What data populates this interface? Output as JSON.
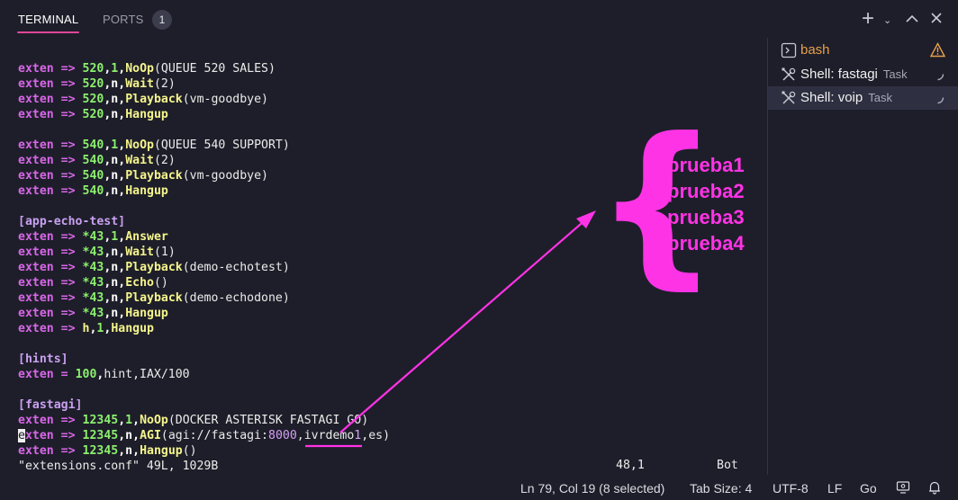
{
  "header": {
    "tab_terminal": "TERMINAL",
    "tab_ports": "PORTS",
    "ports_count": "1",
    "icons": [
      "plus-icon",
      "chevron-down-icon",
      "chevron-up-icon",
      "close-icon"
    ]
  },
  "terminal": {
    "extens": {
      "e1": "exten",
      "e2": "exten",
      "e3": "exten",
      "e4": "exten",
      "e5": "exten",
      "e6": "exten",
      "e7": "exten",
      "e8": "exten",
      "e9": "exten",
      "e10": "exten",
      "e11": "exten",
      "e12": "exten",
      "e13": "exten",
      "e14": "exten",
      "e15": "exten"
    },
    "lines": {
      "l1": {
        "num": "520",
        "prio": "1",
        "app": "NoOp",
        "arg": "(QUEUE 520 SALES)"
      },
      "l2": {
        "num": "520",
        "prio": "n",
        "app": "Wait",
        "arg": "(2)"
      },
      "l3": {
        "num": "520",
        "prio": "n",
        "app": "Playback",
        "arg": "(vm-goodbye)"
      },
      "l4": {
        "num": "520",
        "prio": "n",
        "app": "Hangup",
        "arg": ""
      },
      "l5": {
        "num": "540",
        "prio": "1",
        "app": "NoOp",
        "arg": "(QUEUE 540 SUPPORT)"
      },
      "l6": {
        "num": "540",
        "prio": "n",
        "app": "Wait",
        "arg": "(2)"
      },
      "l7": {
        "num": "540",
        "prio": "n",
        "app": "Playback",
        "arg": "(vm-goodbye)"
      },
      "l8": {
        "num": "540",
        "prio": "n",
        "app": "Hangup",
        "arg": ""
      },
      "l9": {
        "num": "*43",
        "prio": "1",
        "app": "Answer",
        "arg": ""
      },
      "l10": {
        "num": "*43",
        "prio": "n",
        "app": "Wait",
        "arg": "(1)"
      },
      "l11": {
        "num": "*43",
        "prio": "n",
        "app": "Playback",
        "arg": "(demo-echotest)"
      },
      "l12": {
        "num": "*43",
        "prio": "n",
        "app": "Echo",
        "arg": "()"
      },
      "l13": {
        "num": "*43",
        "prio": "n",
        "app": "Playback",
        "arg": "(demo-echodone)"
      },
      "l14": {
        "num": "*43",
        "prio": "n",
        "app": "Hangup",
        "arg": ""
      },
      "l15": {
        "num": "h",
        "prio": "1",
        "app": "Hangup",
        "arg": ""
      },
      "l16": {
        "num": "100",
        "prio": "hint",
        "arg": ",IAX/100"
      },
      "l17": {
        "num": "12345",
        "prio": "1",
        "app": "NoOp",
        "arg": "(DOCKER ASTERISK FASTAGI GO)"
      },
      "l18": {
        "num": "12345",
        "prio": "n",
        "app": "AGI",
        "arg_a": "(agi://fastagi:",
        "arg_port": "8000",
        "arg_b": ",ivrdemo",
        "arg_one": "1",
        "arg_c": ",es)"
      },
      "l19": {
        "num": "12345",
        "prio": "n",
        "app": "Hangup",
        "arg": "()"
      }
    },
    "contexts": {
      "echo": "[app-echo-test]",
      "hints": "[hints]",
      "fastagi": "[fastagi]"
    },
    "arrow": "=>",
    "equals": "=",
    "cursor_char": "e",
    "cursor_rest": "xten",
    "file_status": "\"extensions.conf\" 49L, 1029B",
    "vim_position": "48,1",
    "vim_scroll": "Bot"
  },
  "annotation": {
    "labels": [
      "prueba1",
      "prueba2",
      "prueba3",
      "prueba4"
    ],
    "color": "#ff33e6"
  },
  "sidebar": {
    "items": [
      {
        "label": "bash",
        "sub": "",
        "icon": "terminal-icon",
        "state": "warning-icon"
      },
      {
        "label": "Shell: fastagi",
        "sub": "Task",
        "icon": "tools-icon",
        "state": "loading-icon"
      },
      {
        "label": "Shell: voip",
        "sub": "Task",
        "icon": "tools-icon",
        "state": "loading-icon"
      }
    ]
  },
  "statusbar": {
    "position": "Ln 79, Col 19 (8 selected)",
    "tab_size": "Tab Size: 4",
    "encoding": "UTF-8",
    "eol": "LF",
    "language": "Go",
    "icons": [
      "remote-icon",
      "bell-icon"
    ]
  },
  "colors": {
    "background": "#1e1e2a",
    "keyword": "#d867e8",
    "number": "#8cf06e",
    "application": "#f5f58c",
    "tab_underline": "#e0469a",
    "bash_label": "#e8a04a"
  }
}
